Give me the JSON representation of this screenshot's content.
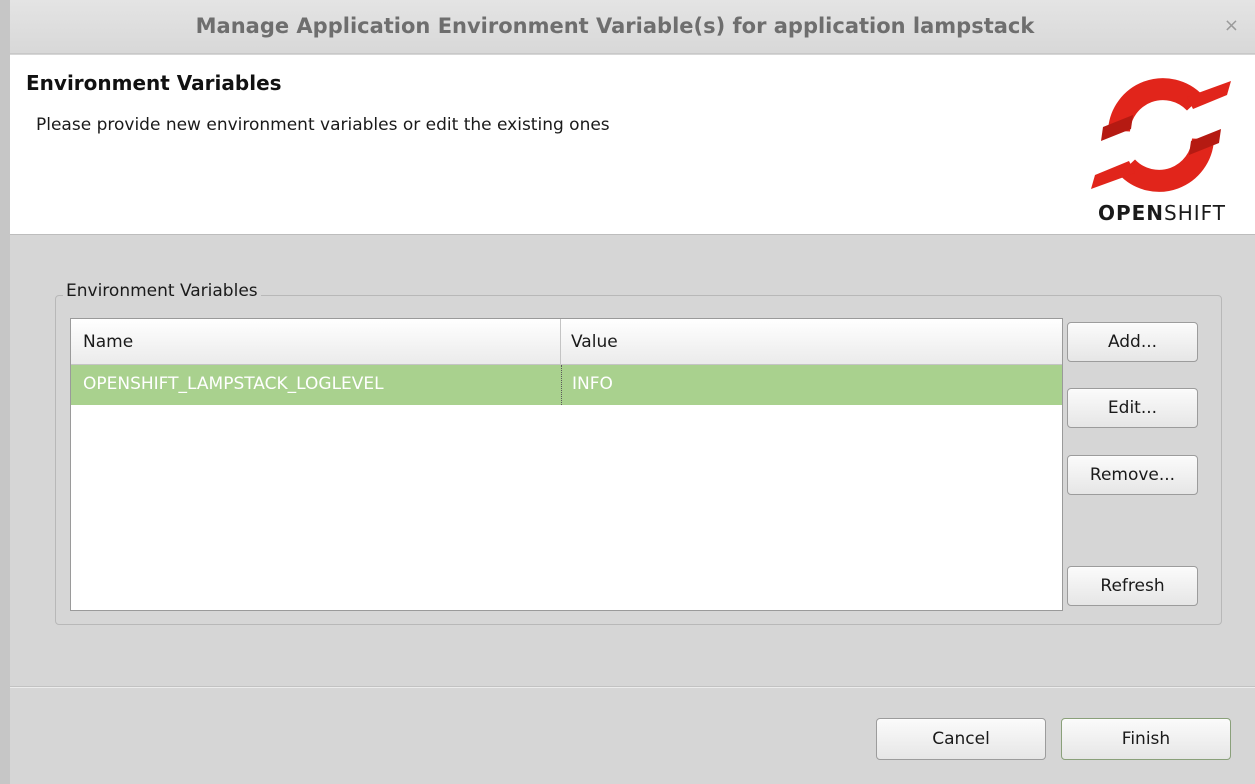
{
  "window": {
    "title": "Manage Application Environment Variable(s) for application lampstack",
    "close_glyph": "×"
  },
  "banner": {
    "title": "Environment Variables",
    "description": "Please provide new environment variables or edit the existing ones",
    "logo": {
      "icon": "openshift-logo-icon",
      "word_bold": "OPEN",
      "word_regular": "SHIFT",
      "color": "#e1251b"
    }
  },
  "group": {
    "legend": "Environment Variables",
    "table": {
      "columns": [
        "Name",
        "Value"
      ],
      "rows": [
        {
          "name": "OPENSHIFT_LAMPSTACK_LOGLEVEL",
          "value": "INFO",
          "selected": true
        }
      ],
      "selection_color": "#a9d18e"
    },
    "buttons": {
      "add": "Add...",
      "edit": "Edit...",
      "remove": "Remove...",
      "refresh": "Refresh"
    }
  },
  "footer": {
    "cancel": "Cancel",
    "finish": "Finish"
  }
}
